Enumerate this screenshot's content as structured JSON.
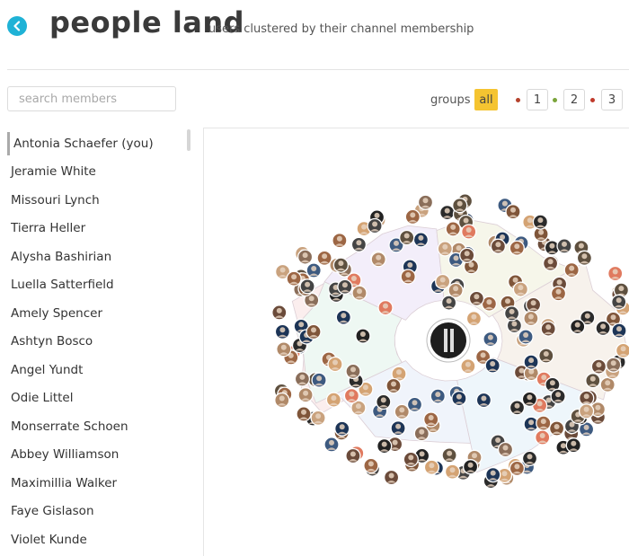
{
  "header": {
    "title": "people land",
    "subtitle": "users clustered by their channel membership"
  },
  "search": {
    "placeholder": "search members",
    "value": ""
  },
  "groups": {
    "label": "groups",
    "all_label": "all",
    "items": [
      {
        "label": "1",
        "color": "#b5422c"
      },
      {
        "label": "2",
        "color": "#7aa43a"
      },
      {
        "label": "3",
        "color": "#c03a2b"
      }
    ]
  },
  "members": [
    "Antonia Schaefer (you)",
    "Jeramie White",
    "Missouri Lynch",
    "Tierra Heller",
    "Alysha Bashirian",
    "Luella Satterfield",
    "Amely Spencer",
    "Ashtyn Bosco",
    "Angel Yundt",
    "Odie Littel",
    "Monserrate Schoen",
    "Abbey Williamson",
    "Maximillia Walker",
    "Faye Gislason",
    "Violet Kunde"
  ],
  "colors": {
    "accent": "#1fb2d6",
    "all_highlight": "#f5c431",
    "cluster_fills": [
      "#fbeeee",
      "#f3eefa",
      "#eef6fb",
      "#f0f4fb",
      "#f7f2ec",
      "#eef8f3",
      "#f6f6ea"
    ]
  }
}
